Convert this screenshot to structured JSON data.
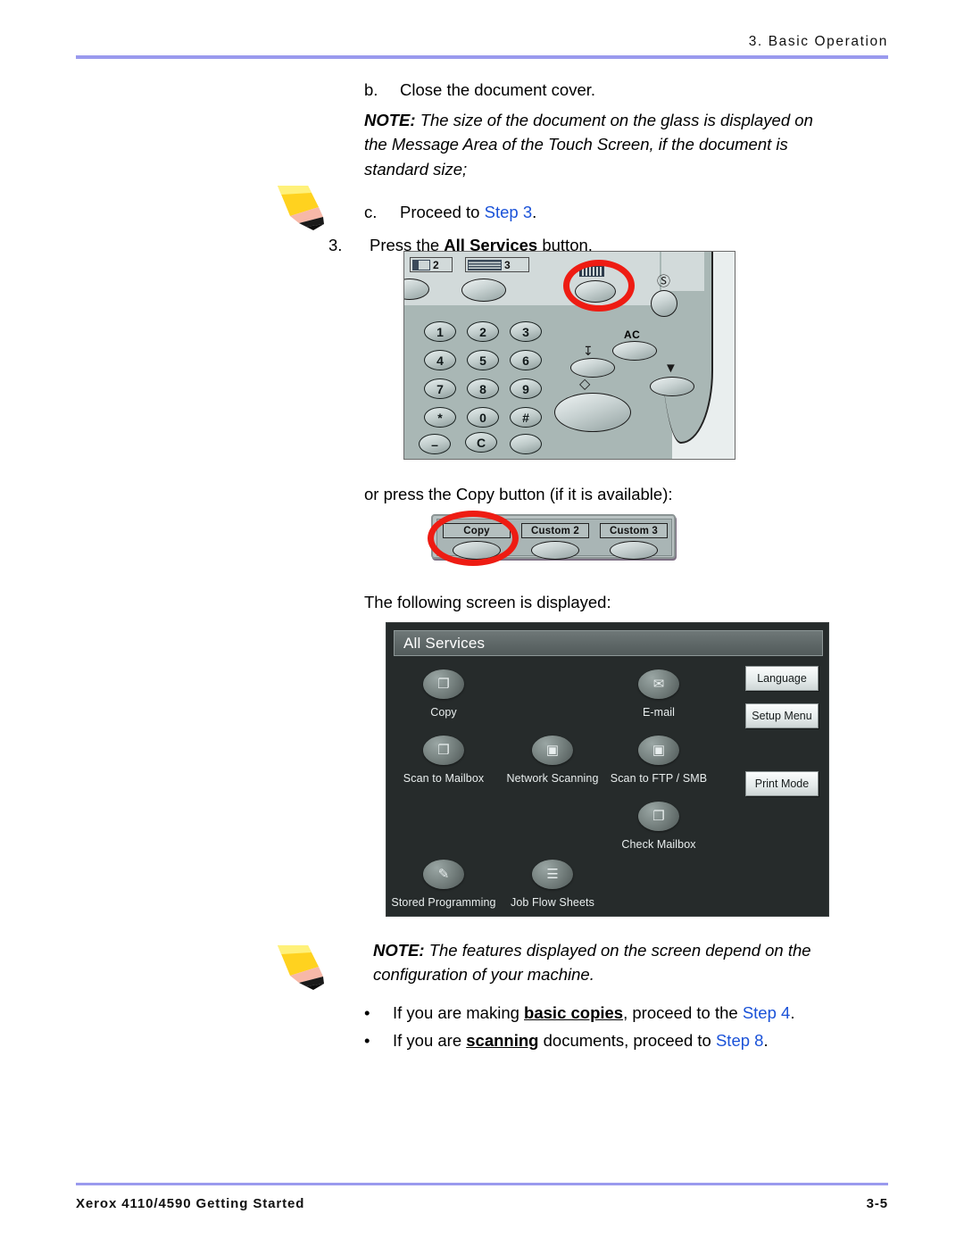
{
  "header": {
    "chapter_title": "3. Basic Operation"
  },
  "footer": {
    "doc_title": "Xerox 4110/4590 Getting Started",
    "page_number": "3-5"
  },
  "body": {
    "step_b": {
      "marker": "b.",
      "text": "Close the document cover."
    },
    "note1": {
      "label": "NOTE:",
      "text": " The size of the document on the glass is displayed on the Message Area of the Touch Screen, if the document is standard size;"
    },
    "step_c": {
      "marker": "c.",
      "text_before": "Proceed to ",
      "link": "Step 3",
      "text_after": "."
    },
    "step_3": {
      "marker": "3.",
      "text_before": "Press the ",
      "bold": "All Services",
      "text_after": " button,"
    },
    "copy_line": "or press the Copy button (if it is available):",
    "screen_line": "The following screen is displayed:",
    "note2": {
      "label": "NOTE:",
      "text": " The features displayed on the screen depend on the configuration of your machine."
    },
    "bullets": [
      {
        "marker": "•",
        "before": "If you are making ",
        "emphasis": "basic copies",
        "middle": ", proceed to the ",
        "link": "Step 4",
        "after": "."
      },
      {
        "marker": "•",
        "before": "If you are ",
        "emphasis": "scanning",
        "middle": " documents, proceed to ",
        "link": "Step 8",
        "after": "."
      }
    ]
  },
  "control_panel": {
    "tabs": [
      {
        "label": "2"
      },
      {
        "label": "3"
      }
    ],
    "keypad": [
      "1",
      "2",
      "3",
      "4",
      "5",
      "6",
      "7",
      "8",
      "9",
      "*",
      "0",
      "#",
      "–",
      "C",
      ""
    ],
    "ac_label": "AC",
    "highlight": "all-services-button"
  },
  "copy_button_panel": {
    "buttons": [
      "Copy",
      "Custom 2",
      "Custom 3"
    ],
    "highlight": "Copy"
  },
  "touch_screen": {
    "title": "All Services",
    "services": [
      {
        "label": "Copy",
        "icon": "copy-icon",
        "glyph": "❐"
      },
      {
        "label": "E-mail",
        "icon": "email-icon",
        "glyph": "✉"
      },
      {
        "label": "Scan to Mailbox",
        "icon": "scan-to-mailbox-icon",
        "glyph": "❐"
      },
      {
        "label": "Network Scanning",
        "icon": "network-scanning-icon",
        "glyph": "▣"
      },
      {
        "label": "Scan to FTP / SMB",
        "icon": "scan-to-ftp-smb-icon",
        "glyph": "▣"
      },
      {
        "label": "Check Mailbox",
        "icon": "check-mailbox-icon",
        "glyph": "❐"
      },
      {
        "label": "Stored Programming",
        "icon": "stored-programming-icon",
        "glyph": "✎"
      },
      {
        "label": "Job Flow Sheets",
        "icon": "job-flow-sheets-icon",
        "glyph": "☰"
      }
    ],
    "side_buttons": [
      "Language",
      "Setup Menu",
      "Print Mode"
    ]
  },
  "colors": {
    "rule": "#9a9aee",
    "link": "#1a52d8",
    "highlight_ring": "#ee1c13",
    "screen_background": "#262b2b"
  }
}
